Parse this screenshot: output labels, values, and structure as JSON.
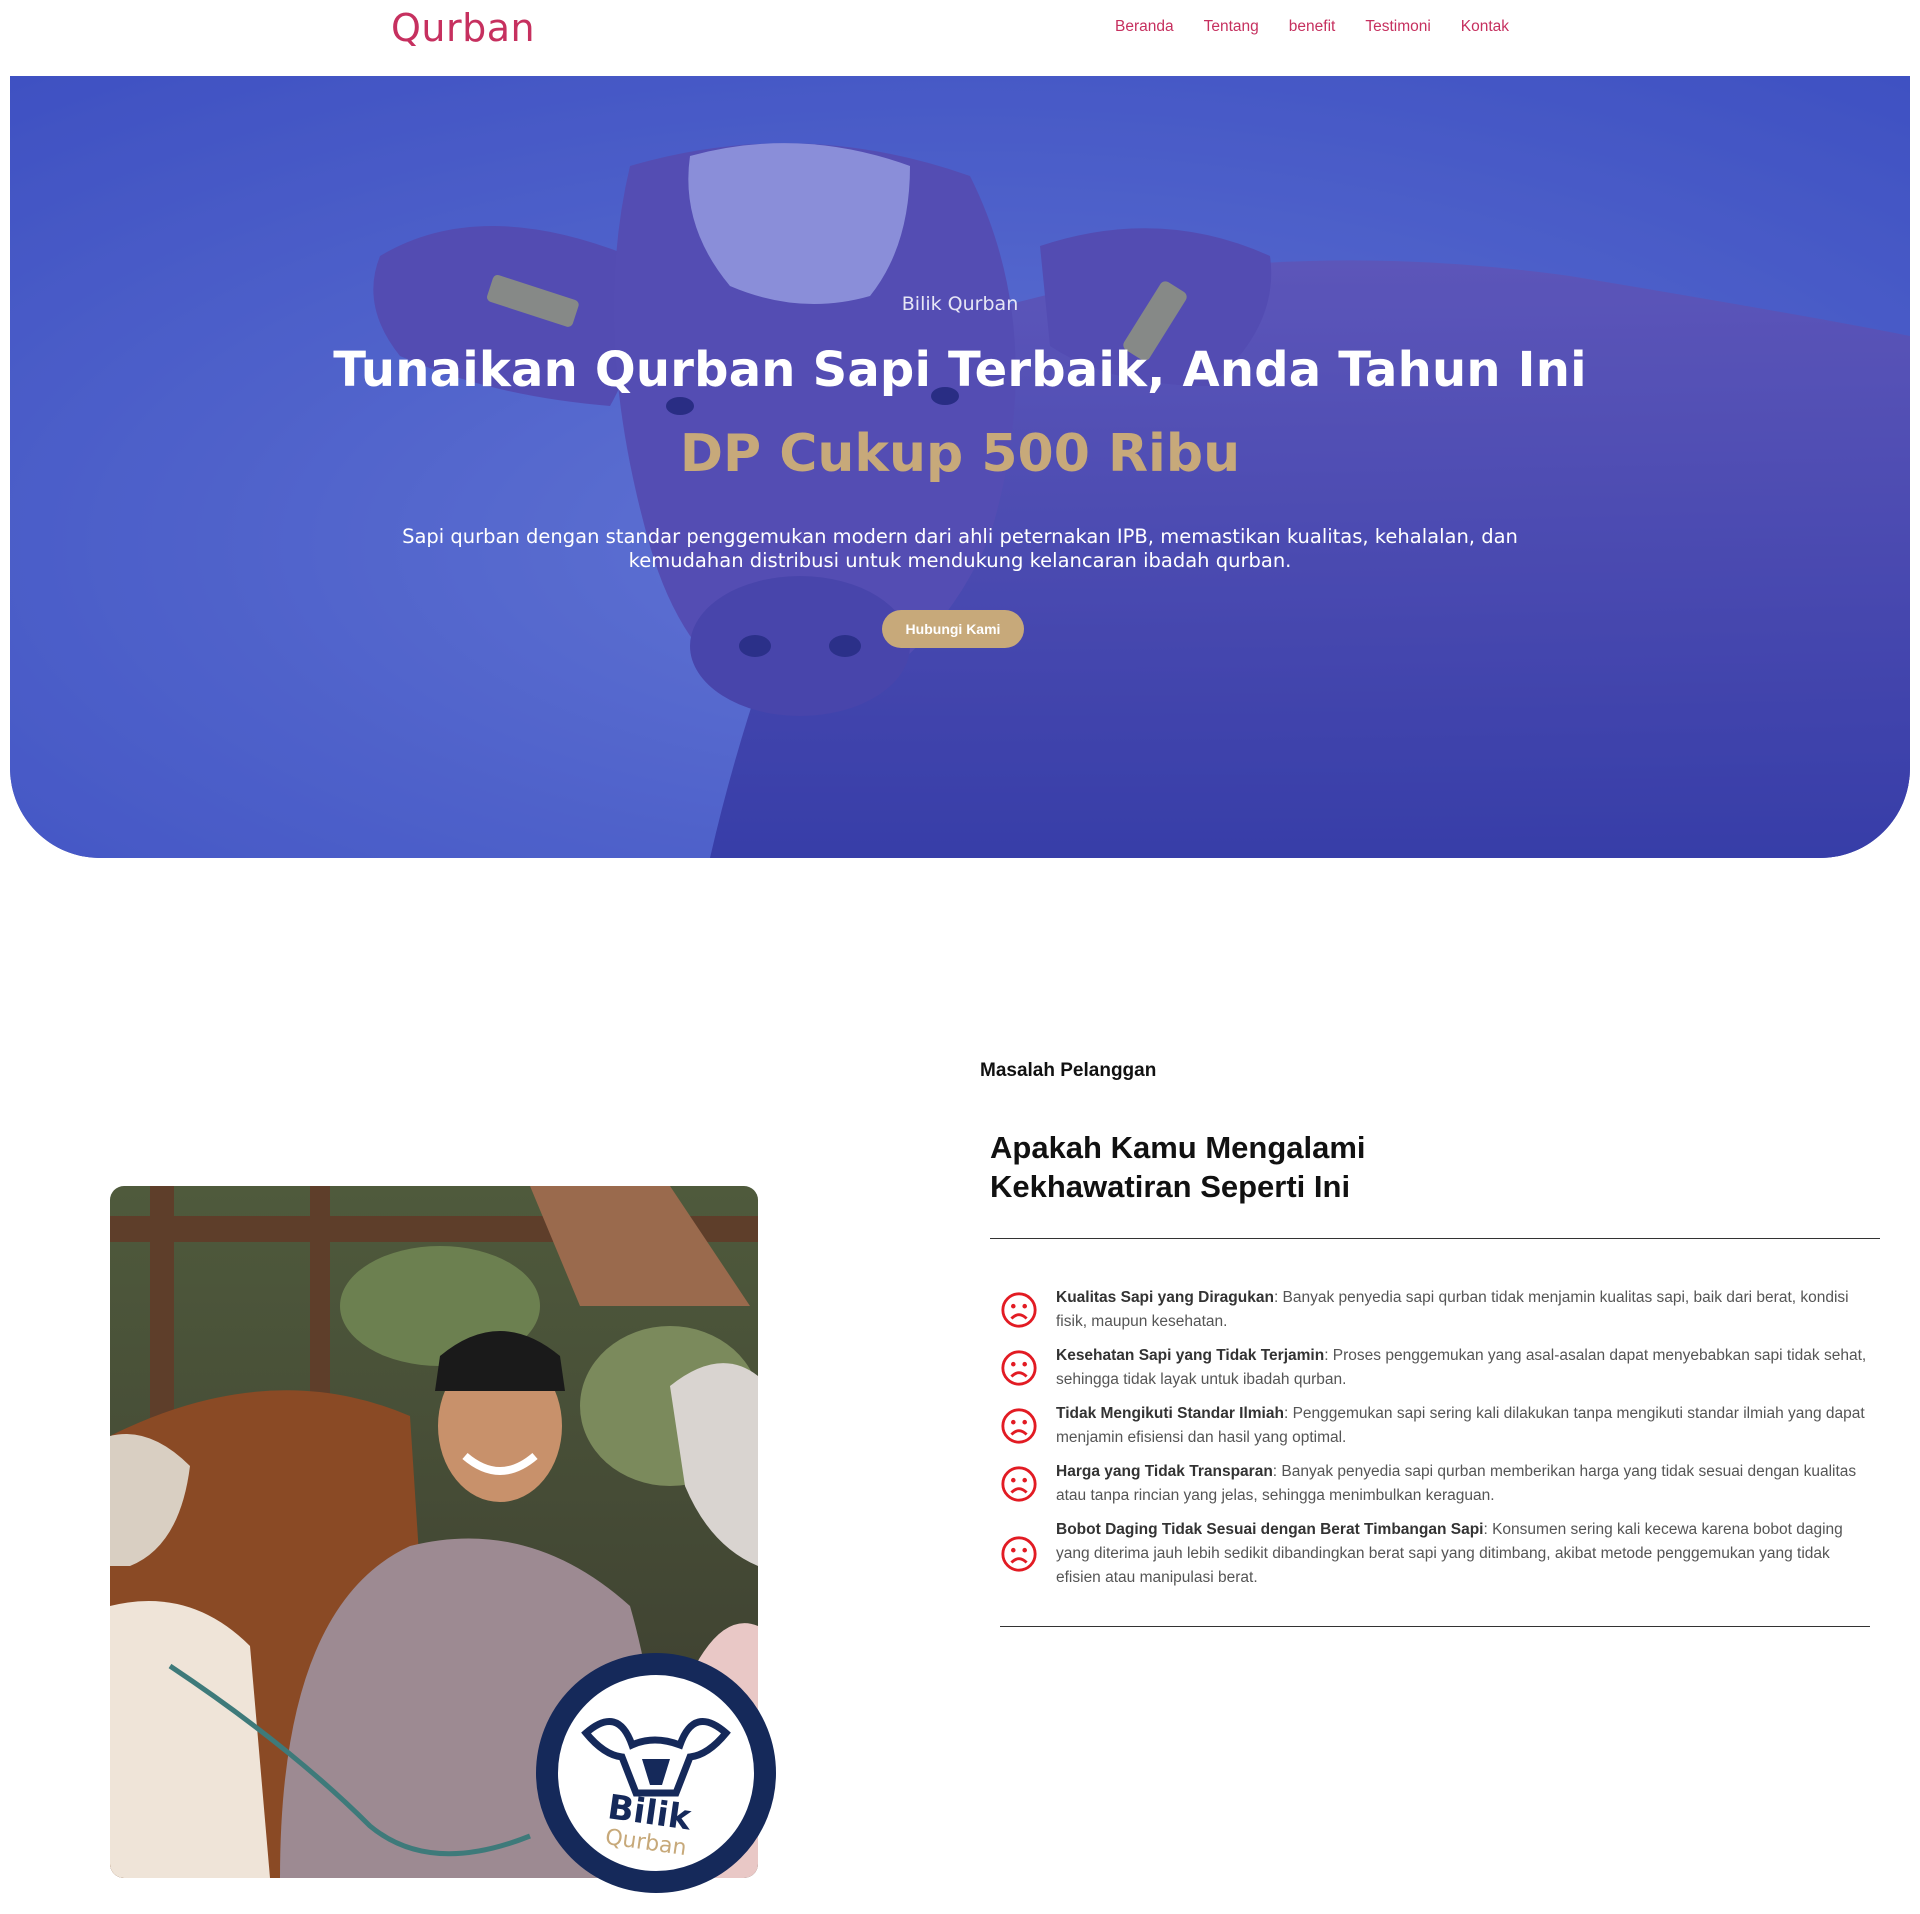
{
  "header": {
    "brand": "Qurban",
    "nav": [
      "Beranda",
      "Tentang",
      "benefit",
      "Testimoni",
      "Kontak"
    ]
  },
  "hero": {
    "eyebrow": "Bilik Qurban",
    "title": "Tunaikan Qurban Sapi Terbaik, Anda Tahun Ini",
    "subtitle": "DP Cukup 500 Ribu",
    "description": "Sapi qurban dengan standar penggemukan modern dari ahli peternakan IPB, memastikan kualitas, kehalalan, dan kemudahan distribusi untuk mendukung kelancaran ibadah qurban.",
    "button": "Hubungi Kami"
  },
  "problems": {
    "eyebrow": "Masalah Pelanggan",
    "title": "Apakah Kamu Mengalami Kekhawatiran Seperti Ini",
    "items": [
      {
        "head": "Kualitas Sapi yang Diragukan",
        "text": ": Banyak penyedia sapi qurban tidak menjamin kualitas sapi, baik dari berat, kondisi fisik, maupun kesehatan."
      },
      {
        "head": "Kesehatan Sapi yang Tidak Terjamin",
        "text": ": Proses penggemukan yang asal-asalan dapat menyebabkan sapi tidak sehat, sehingga tidak layak untuk ibadah qurban."
      },
      {
        "head": "Tidak Mengikuti Standar Ilmiah",
        "text": ": Penggemukan sapi sering kali dilakukan tanpa mengikuti standar ilmiah yang dapat menjamin efisiensi dan hasil yang optimal."
      },
      {
        "head": "Harga yang Tidak Transparan",
        "text": ": Banyak penyedia sapi qurban memberikan harga yang tidak sesuai dengan kualitas atau tanpa rincian yang jelas, sehingga menimbulkan keraguan."
      },
      {
        "head": "Bobot Daging Tidak Sesuai dengan Berat Timbangan Sapi",
        "text": ": Konsumen sering kali kecewa karena bobot daging yang diterima jauh lebih sedikit dibandingkan berat sapi yang ditimbang, akibat metode penggemukan yang tidak efisien atau manipulasi berat."
      }
    ]
  },
  "badge": {
    "line1": "Bilik",
    "line2": "Qurban"
  },
  "icons": {
    "item_icon": "sad-face-icon"
  },
  "colors": {
    "brand": "#c6305f",
    "accent": "#c7a97a",
    "hero_overlay": "#3f53c2",
    "badge_ring": "#15295a",
    "sad_icon": "#e21b23"
  }
}
